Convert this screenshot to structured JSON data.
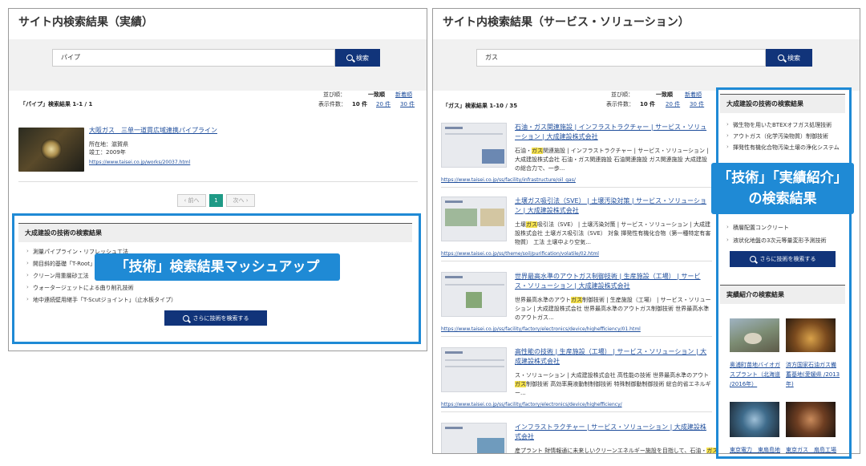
{
  "left": {
    "title": "サイト内検索結果（実績）",
    "search_value": "パイプ",
    "search_button": "検索",
    "sort_label": "並び順：",
    "sort_active": "一致順",
    "sort_link": "新着順",
    "per_page_label": "表示件数：",
    "per_page_active": "10 件",
    "per_page_20": "20 件",
    "per_page_30": "30 件",
    "result_count": "「パイプ」検索結果 1-1 / 1",
    "result": {
      "title": "大阪ガス　三单一道貫広域連携パイプライン",
      "location": "所在地：滋賀県",
      "completed": "竣工：2009年",
      "url": "https://www.taisei.co.jp/works/20037.html"
    },
    "pager": {
      "prev": "‹ 前へ",
      "current": "1",
      "next": "次へ ›"
    },
    "tech": {
      "heading": "大成建設の技術の検索結果",
      "items": [
        "測量パイプライン・リフレッシュ工法",
        "開目斜的基礎「T-Root」",
        "クリーン用重層砂工法",
        "ウォータージェットによる曲り削孔技術",
        "地中連続壁用継手「T-Scutジョイント」（止水板タイプ）"
      ],
      "more_button": "さらに技術を検索する"
    },
    "callout": "「技術」検索結果マッシュアップ"
  },
  "right": {
    "title": "サイト内検索結果（サービス・ソリューション）",
    "search_value": "ガス",
    "search_button": "検索",
    "sort_label": "並び順：",
    "sort_active": "一致順",
    "sort_link": "新着順",
    "per_page_label": "表示件数：",
    "per_page_active": "10 件",
    "per_page_20": "20 件",
    "per_page_30": "30 件",
    "result_count": "「ガス」検索結果 1-10 / 35",
    "results": [
      {
        "title": "石油・ガス関連施設 | インフラストラクチャー | サービス・ソリューション | 大成建設株式会社",
        "desc_a": "石油・",
        "desc_hl": "ガス",
        "desc_b": "関連施設 | インフラストラクチャー | サービス・ソリューション | 大成建設株式会社 石油・ガス関連施設 石油関連施設 ガス関連施設 大成建設の総合力で、一歩...",
        "url": "https://www.taisei.co.jp/ss/facility/infrastructure/oil_gas/"
      },
      {
        "title": "土壌ガス吸引法（SVE） | 土壌汚染対策 | サービス・ソリューション | 大成建設株式会社",
        "desc_a": "土壌",
        "desc_hl": "ガス",
        "desc_b": "吸引法（SVE） | 土壌汚染対策 | サービス・ソリューション | 大成建設株式会社 土壌ガス吸引法（SVE） 対象 揮発性有機化合物（第一種特定有害物質） 工法 土壌中より空気...",
        "url": "https://www.taisei.co.jp/ss/theme/soil/purification/volatile/02.html"
      },
      {
        "title": "世界最高水準のアウトガス制御技術 | 生産施設（工場） | サービス・ソリューション | 大成建設株式会社",
        "desc_a": "世界最高水準のアウト",
        "desc_hl": "ガス",
        "desc_b": "制御技術 | 生産施設（工場） | サービス・ソリューション | 大成建設株式会社 世界最高水準のアウトガス制御技術 世界最高水準のアウトガス...",
        "url": "https://www.taisei.co.jp/ss/facility/factory/electronics/device/highefficiency/01.html"
      },
      {
        "title": "高性能の技術 | 生産施設（工場） | サービス・ソリューション | 大成建設株式会社",
        "desc_a": "ス・ソリューション | 大成建設株式会社 高性能の技術 世界最高水準のアウト",
        "desc_hl": "ガス",
        "desc_b": "制御技術 高効率廃液動制制御技術 特殊制御動制御技術 総合的省エネルギー...",
        "url": "https://www.taisei.co.jp/ss/facility/factory/electronics/device/highefficiency/"
      },
      {
        "title": "インフラストラクチャー | サービス・ソリューション | 大成建設株式会社",
        "desc_a": "産プラント 財情報通に未来しいクリーンエネルギー施設を目指して、石油・",
        "desc_hl": "ガス",
        "desc_b": "",
        "url": ""
      }
    ],
    "tech": {
      "heading": "大成建設の技術の検索結果",
      "items": [
        "微生物を用いたBTEXオフガス処理技術",
        "アウトガス（化学汚染物質）制御技術",
        "揮発性有機化合物汚染土壌の浄化システム",
        "",
        "",
        "",
        "",
        "積層配置コンクリート",
        "液状化地盤の3次元等量変形予測技術"
      ],
      "more_button": "さらに技術を検索する"
    },
    "works": {
      "heading": "実績紹介の検索結果",
      "items": [
        {
          "caption": "奥浦町苗地バイオガスプラント（北海道 /2016年）"
        },
        {
          "caption": "済方国家石油ガス備蓄基地(愛媛県 /2013年)"
        },
        {
          "caption": "東京電力　東扇島地"
        },
        {
          "caption": "東京ガス　扇島工場"
        }
      ]
    },
    "callout_line1": "「技術」「実績紹介」",
    "callout_line2": "の検索結果"
  }
}
